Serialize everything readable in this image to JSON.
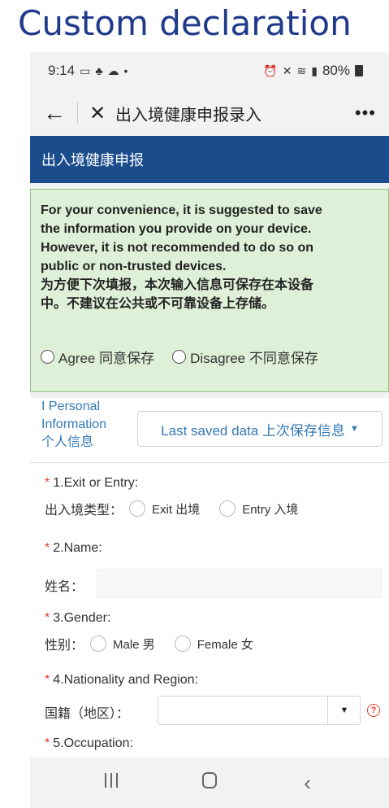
{
  "slide": {
    "title": "Custom declaration"
  },
  "status_bar": {
    "time": "9:14",
    "battery": "80%"
  },
  "nav": {
    "title": "出入境健康申报录入",
    "more": "•••"
  },
  "header": {
    "title": "出入境健康申报"
  },
  "notice": {
    "en_lines": [
      "For your convenience, it is suggested to save",
      "the information you provide on your device.",
      "However, it is not recommended to do so on",
      "public or non-trusted devices."
    ],
    "zh_lines": [
      "为方便下次填报，本次输入信息可保存在本设备",
      "中。不建议在公共或不可靠设备上存储。"
    ],
    "agree": "Agree 同意保存",
    "disagree": "Disagree 不同意保存"
  },
  "personal": {
    "label_lines": [
      "I Personal",
      "Information",
      "个人信息"
    ],
    "saved_button": "Last saved data 上次保存信息"
  },
  "form": {
    "q1": {
      "label": "1.Exit or Entry:",
      "prefix": "出入境类型：",
      "options": [
        "Exit 出境",
        "Entry 入境"
      ]
    },
    "q2": {
      "label": "2.Name:",
      "prefix": "姓名："
    },
    "q3": {
      "label": "3.Gender:",
      "prefix": "性别：",
      "options": [
        "Male 男",
        "Female 女"
      ]
    },
    "q4": {
      "label": "4.Nationality and Region:",
      "prefix": "国籍（地区）："
    },
    "q5": {
      "label": "5.Occupation:"
    },
    "required_mark": "*"
  },
  "colors": {
    "title_blue": "#1f3a8a",
    "header_blue": "#1b4d8c",
    "notice_green_bg": "#dff0d8",
    "link_blue": "#337ab7",
    "required_red": "#e53b2c"
  }
}
